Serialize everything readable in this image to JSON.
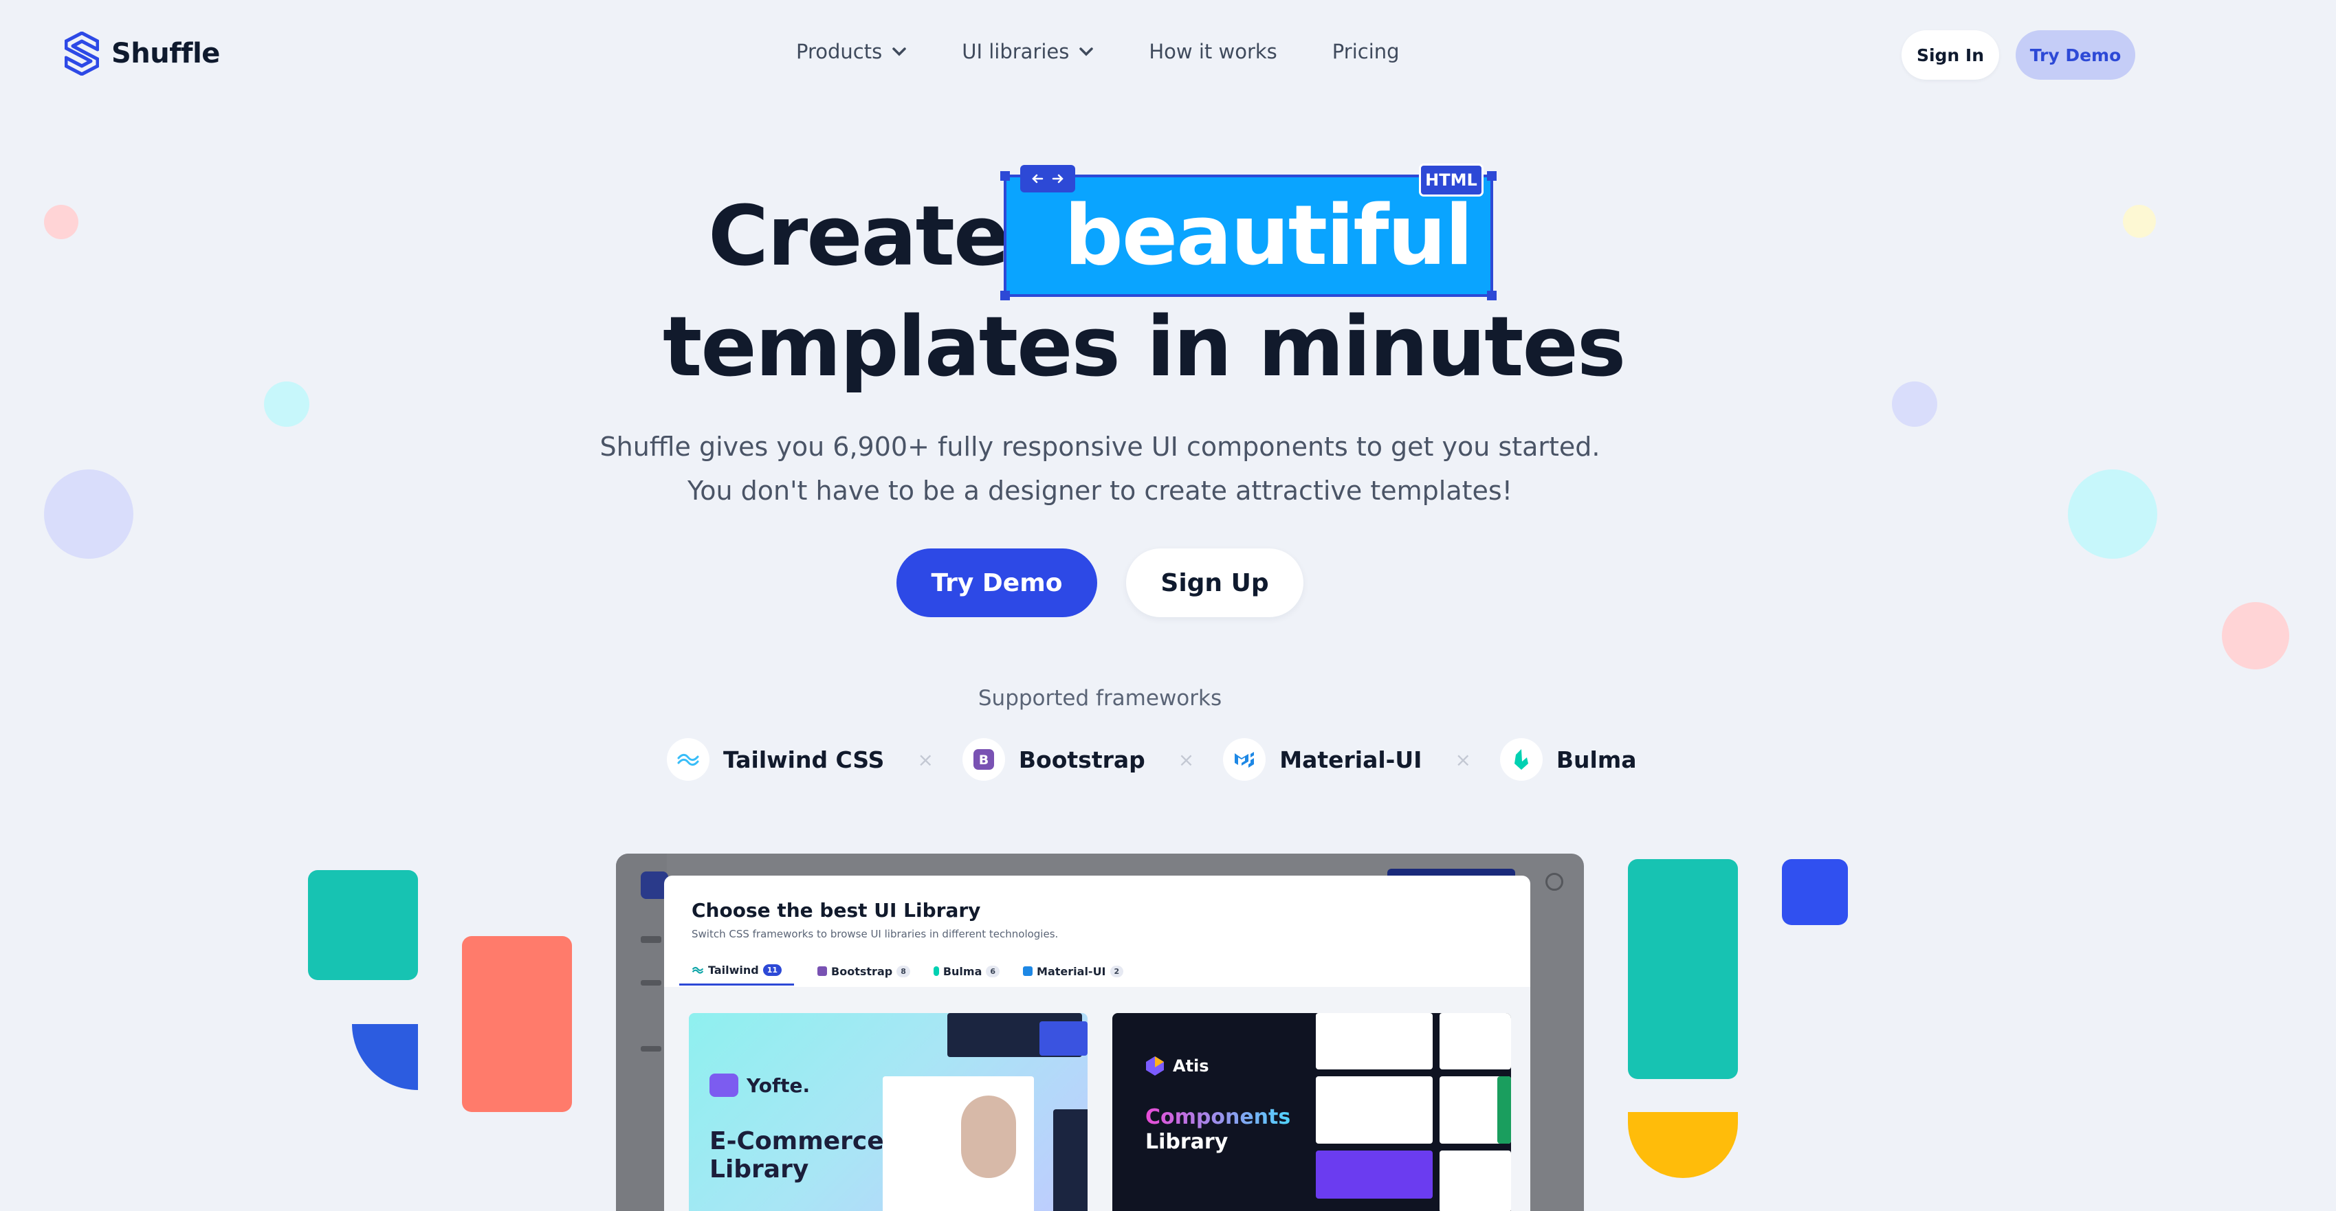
{
  "brand": {
    "name": "Shuffle"
  },
  "nav": {
    "items": [
      {
        "label": "Products",
        "dropdown": true
      },
      {
        "label": "UI libraries",
        "dropdown": true
      },
      {
        "label": "How it works",
        "dropdown": false
      },
      {
        "label": "Pricing",
        "dropdown": false
      }
    ],
    "sign_in": "Sign In",
    "try_demo": "Try Demo"
  },
  "hero": {
    "word1": "Create",
    "highlight": "beautiful",
    "line2": "templates in minutes",
    "badge": "HTML",
    "sub1": "Shuffle gives you 6,900+ fully responsive UI components to get you started.",
    "sub2": "You don't have to be a designer to create attractive templates!",
    "cta_primary": "Try Demo",
    "cta_secondary": "Sign Up"
  },
  "frameworks": {
    "title": "Supported frameworks",
    "separator": "×",
    "items": [
      {
        "label": "Tailwind CSS",
        "icon": "tailwind-icon",
        "color": "#38bdf8"
      },
      {
        "label": "Bootstrap",
        "icon": "bootstrap-icon",
        "color": "#7952b3"
      },
      {
        "label": "Material-UI",
        "icon": "material-ui-icon",
        "color": "#1e88e5"
      },
      {
        "label": "Bulma",
        "icon": "bulma-icon",
        "color": "#00d1b2"
      }
    ]
  },
  "preview": {
    "modal_title": "Choose the best UI Library",
    "modal_subtitle": "Switch CSS frameworks to browse UI libraries in different technologies.",
    "tabs": [
      {
        "label": "Tailwind",
        "count": "11",
        "active": true
      },
      {
        "label": "Bootstrap",
        "count": "8",
        "active": false
      },
      {
        "label": "Bulma",
        "count": "6",
        "active": false
      },
      {
        "label": "Material-UI",
        "count": "2",
        "active": false
      }
    ],
    "card1": {
      "brand": "Yofte.",
      "line1": "E-Commerce",
      "line2": "Library"
    },
    "card2": {
      "brand": "Atis",
      "line1": "Components",
      "line2": "Library"
    }
  },
  "colors": {
    "primary": "#2d49e6",
    "highlight_bg": "#0aa4ff",
    "background": "#eff2f8",
    "teal": "#17c3b2",
    "coral": "#ff7b6b",
    "yellow": "#ffbc0a"
  }
}
